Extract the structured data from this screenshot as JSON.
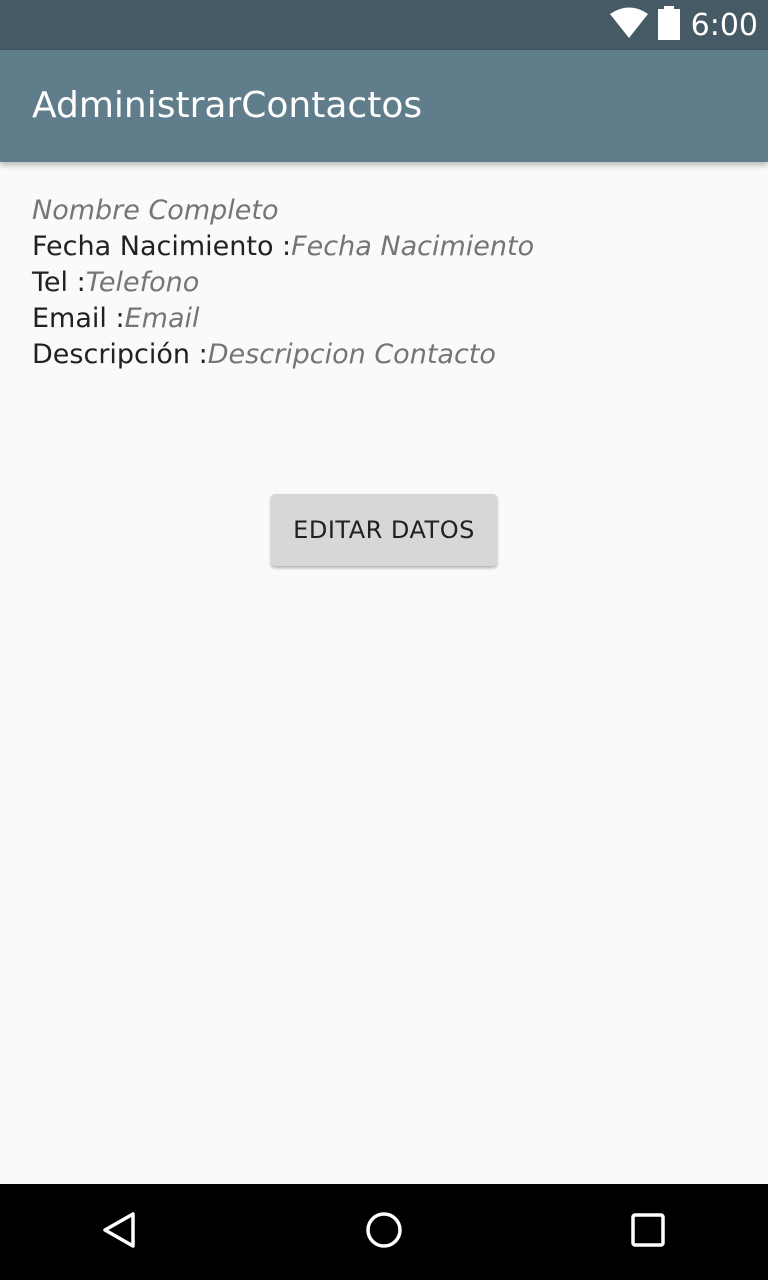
{
  "status_bar": {
    "time": "6:00",
    "icons": [
      "wifi-icon",
      "battery-icon"
    ]
  },
  "app_bar": {
    "title": "AdministrarContactos"
  },
  "contact": {
    "name_hint": "Nombre Completo",
    "birthdate_label": "Fecha Nacimiento :",
    "birthdate_hint": "Fecha Nacimiento",
    "phone_label": "Tel :",
    "phone_hint": "Telefono",
    "email_label": "Email :",
    "email_hint": "Email",
    "description_label": "Descripción :",
    "description_hint": "Descripcion Contacto"
  },
  "actions": {
    "edit_label": "EDITAR DATOS"
  },
  "nav_bar": {
    "buttons": [
      "back-icon",
      "home-icon",
      "recents-icon"
    ]
  },
  "colors": {
    "status_bar": "#455a64",
    "app_bar": "#607d8b",
    "background": "#fafafa",
    "button": "#d6d7d7",
    "hint_text": "#757575"
  }
}
